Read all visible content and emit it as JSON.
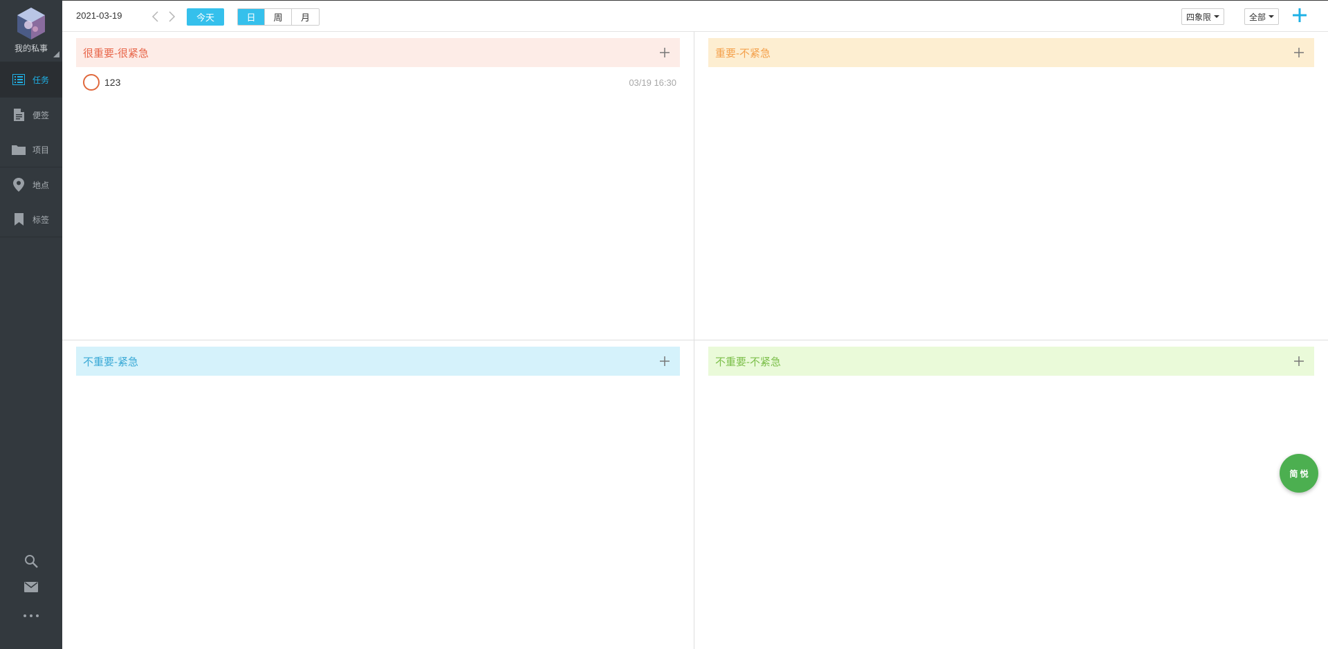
{
  "sidebar": {
    "profile_name": "我的私事",
    "items": [
      {
        "label": "任务",
        "icon": "task-list-icon"
      },
      {
        "label": "便签",
        "icon": "note-icon"
      },
      {
        "label": "项目",
        "icon": "folder-icon"
      },
      {
        "label": "地点",
        "icon": "location-pin-icon"
      },
      {
        "label": "标签",
        "icon": "bookmark-icon"
      }
    ],
    "bottom_icons": [
      "search-icon",
      "mail-icon",
      "more-icon"
    ]
  },
  "toolbar": {
    "date": "2021-03-19",
    "today_label": "今天",
    "views": [
      "日",
      "周",
      "月"
    ],
    "active_view": "日",
    "layout_dropdown": "四象限",
    "filter_dropdown": "全部"
  },
  "quadrants": [
    {
      "title": "很重要-很紧急",
      "color": "#e8664a",
      "bg": "#fdece7",
      "tasks": [
        {
          "title": "123",
          "time": "03/19 16:30"
        }
      ]
    },
    {
      "title": "重要-不紧急",
      "color": "#f4a14c",
      "bg": "#fdeed1",
      "tasks": []
    },
    {
      "title": "不重要-紧急",
      "color": "#39a9d6",
      "bg": "#d5f2fb",
      "tasks": []
    },
    {
      "title": "不重要-不紧急",
      "color": "#7cbf4a",
      "bg": "#eafad9",
      "tasks": []
    }
  ],
  "fab_label": "简 悦",
  "colors": {
    "accent": "#35c0ec",
    "sidebar": "#33393e",
    "fab": "#4caf50"
  }
}
